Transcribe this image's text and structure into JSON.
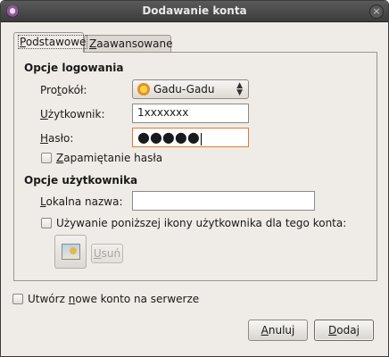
{
  "window": {
    "title": "Dodawanie konta",
    "close_glyph": "×"
  },
  "tabs": [
    {
      "label_pre": "",
      "mnemonic": "P",
      "label_post": "odstawowe"
    },
    {
      "label_pre": "",
      "mnemonic": "Z",
      "label_post": "aawansowane"
    }
  ],
  "login_options": {
    "heading": "Opcje logowania",
    "protocol_label": {
      "pre": "Pro",
      "mnemonic": "t",
      "post": "okół:"
    },
    "protocol_value": "Gadu-Gadu",
    "username_label": {
      "pre": "",
      "mnemonic": "U",
      "post": "żytkownik:"
    },
    "username_value": "1xxxxxxx",
    "password_label": {
      "pre": "",
      "mnemonic": "H",
      "post": "asło:"
    },
    "password_dots": "●●●●●",
    "remember_label": {
      "pre": "",
      "mnemonic": "Z",
      "post": "apamiętanie hasła"
    }
  },
  "user_options": {
    "heading": "Opcje użytkownika",
    "local_name_label": {
      "pre": "",
      "mnemonic": "L",
      "post": "okalna nazwa:"
    },
    "local_name_value": "",
    "use_icon_label": "Używanie poniższej ikony użytkownika dla tego konta:",
    "remove_label": {
      "pre": "",
      "mnemonic": "U",
      "post": "suń"
    }
  },
  "create_account_label": {
    "pre": "Utwórz ",
    "mnemonic": "n",
    "post": "owe konto na serwerze"
  },
  "buttons": {
    "cancel": {
      "pre": "",
      "mnemonic": "A",
      "post": "nuluj"
    },
    "add": {
      "pre": "",
      "mnemonic": "D",
      "post": "odaj"
    }
  },
  "colors": {
    "focus_border": "#e07b33",
    "titlebar": "#4a4a4a",
    "dialog_bg": "#efebe7"
  }
}
